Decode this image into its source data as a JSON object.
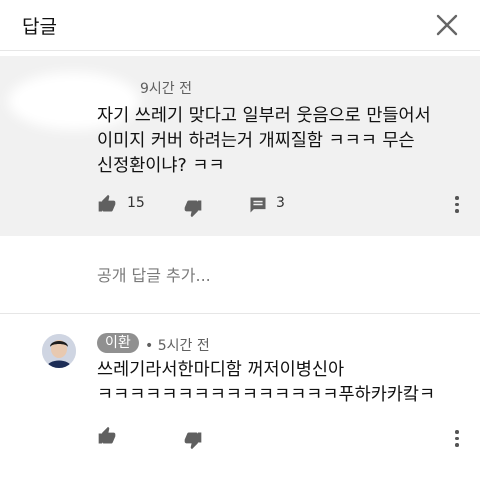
{
  "header": {
    "title": "답글",
    "close_icon": "close-icon"
  },
  "parent_comment": {
    "time": "9시간 전",
    "text": "자기 쓰레기 맞다고 일부러 웃음으로 만들어서\n이미지 커버 하려는거 개찌질함 ㅋㅋㅋ 무슨\n신정환이냐? ㅋㅋ",
    "likes": "15",
    "replies": "3"
  },
  "add_reply": {
    "placeholder": "공개 답글 추가..."
  },
  "reply": {
    "author": "이환",
    "separator": "•",
    "time": "5시간 전",
    "text": "쓰레기라서한마디함 꺼저이병신아\nㅋㅋㅋㅋㅋㅋㅋㅋㅋㅋㅋㅋㅋㅋㅋ푸하카카캌ㅋ"
  },
  "colors": {
    "parent_bg": "#f1f1f1",
    "badge_bg": "#909090",
    "icon": "#606060"
  }
}
